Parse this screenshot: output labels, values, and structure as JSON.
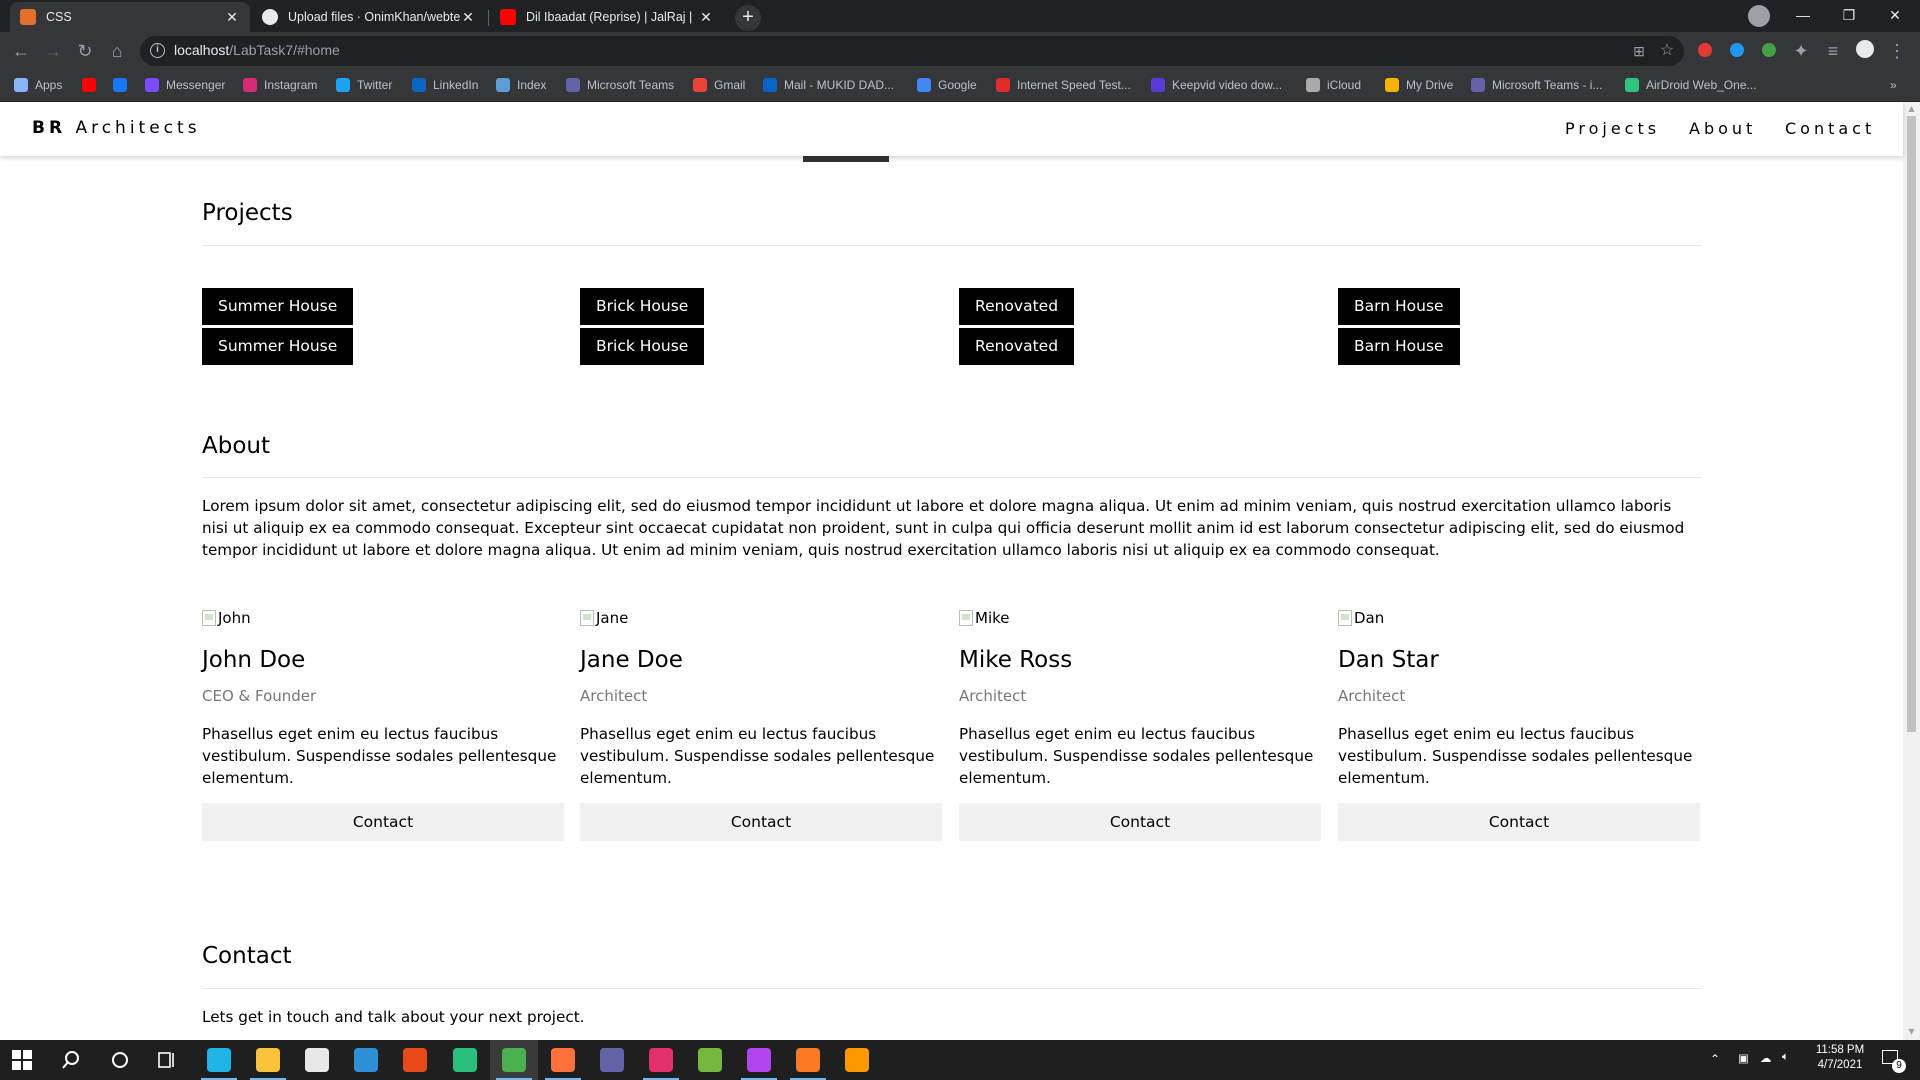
{
  "browser": {
    "tabs": [
      {
        "title": "CSS",
        "favicon_color": "#e3702d",
        "active": true
      },
      {
        "title": "Upload files · OnimKhan/webtech",
        "favicon_color": "#e8eaed",
        "active": false
      },
      {
        "title": "Dil Ibaadat (Reprise) | JalRaj |",
        "favicon_color": "#ff0000",
        "active": false
      }
    ],
    "address": {
      "host": "localhost",
      "path": "/LabTask7/#home"
    },
    "bookmarks": [
      {
        "label": "Apps",
        "icon": "apps-grid-icon",
        "color": "#8ab4f8"
      },
      {
        "label": "",
        "icon": "youtube-icon",
        "color": "#ff0000"
      },
      {
        "label": "",
        "icon": "facebook-icon",
        "color": "#1877f2"
      },
      {
        "label": "Messenger",
        "icon": "messenger-icon",
        "color": "#7b4dff"
      },
      {
        "label": "Instagram",
        "icon": "instagram-icon",
        "color": "#d62976"
      },
      {
        "label": "Twitter",
        "icon": "twitter-icon",
        "color": "#1da1f2"
      },
      {
        "label": "LinkedIn",
        "icon": "linkedin-icon",
        "color": "#0a66c2"
      },
      {
        "label": "Index",
        "icon": "index-icon",
        "color": "#5f9bd5"
      },
      {
        "label": "Microsoft Teams",
        "icon": "teams-icon",
        "color": "#6264a7"
      },
      {
        "label": "Gmail",
        "icon": "gmail-icon",
        "color": "#ea4335"
      },
      {
        "label": "Mail - MUKID DAD...",
        "icon": "outlook-icon",
        "color": "#0a64c8"
      },
      {
        "label": "Google",
        "icon": "google-icon",
        "color": "#4285f4"
      },
      {
        "label": "Internet Speed Test...",
        "icon": "speedtest-icon",
        "color": "#e22b2b"
      },
      {
        "label": "Keepvid video dow...",
        "icon": "keepvid-icon",
        "color": "#5b3bd6"
      },
      {
        "label": "iCloud",
        "icon": "apple-icon",
        "color": "#aaaaaa"
      },
      {
        "label": "My Drive",
        "icon": "drive-icon",
        "color": "#f4b400"
      },
      {
        "label": "Microsoft Teams - i...",
        "icon": "teams-icon",
        "color": "#6264a7"
      },
      {
        "label": "AirDroid Web_One...",
        "icon": "airdroid-icon",
        "color": "#31c27c"
      }
    ]
  },
  "site": {
    "brand_bold": "BR",
    "brand_rest": "Architects",
    "nav": [
      "Projects",
      "About",
      "Contact"
    ],
    "projects": {
      "title": "Projects",
      "tags": [
        [
          "Summer House",
          "Summer House"
        ],
        [
          "Brick House",
          "Brick House"
        ],
        [
          "Renovated",
          "Renovated"
        ],
        [
          "Barn House",
          "Barn House"
        ]
      ]
    },
    "about": {
      "title": "About",
      "text": "Lorem ipsum dolor sit amet, consectetur adipiscing elit, sed do eiusmod tempor incididunt ut labore et dolore magna aliqua. Ut enim ad minim veniam, quis nostrud exercitation ullamco laboris nisi ut aliquip ex ea commodo consequat. Excepteur sint occaecat cupidatat non proident, sunt in culpa qui officia deserunt mollit anim id est laborum consectetur adipiscing elit, sed do eiusmod tempor incididunt ut labore et dolore magna aliqua. Ut enim ad minim veniam, quis nostrud exercitation ullamco laboris nisi ut aliquip ex ea commodo consequat."
    },
    "team": [
      {
        "alt": "John",
        "name": "John Doe",
        "role": "CEO & Founder",
        "bio": "Phasellus eget enim eu lectus faucibus vestibulum. Suspendisse sodales pellentesque elementum.",
        "button": "Contact"
      },
      {
        "alt": "Jane",
        "name": "Jane Doe",
        "role": "Architect",
        "bio": "Phasellus eget enim eu lectus faucibus vestibulum. Suspendisse sodales pellentesque elementum.",
        "button": "Contact"
      },
      {
        "alt": "Mike",
        "name": "Mike Ross",
        "role": "Architect",
        "bio": "Phasellus eget enim eu lectus faucibus vestibulum. Suspendisse sodales pellentesque elementum.",
        "button": "Contact"
      },
      {
        "alt": "Dan",
        "name": "Dan Star",
        "role": "Architect",
        "bio": "Phasellus eget enim eu lectus faucibus vestibulum. Suspendisse sodales pellentesque elementum.",
        "button": "Contact"
      }
    ],
    "contact": {
      "title": "Contact",
      "text": "Lets get in touch and talk about your next project."
    }
  },
  "taskbar": {
    "apps": [
      {
        "icon": "edge-icon",
        "color": "#1fb4e6"
      },
      {
        "icon": "file-explorer-icon",
        "color": "#f9c23c"
      },
      {
        "icon": "store-icon",
        "color": "#e8e8e8"
      },
      {
        "icon": "mail-icon",
        "color": "#2d8fd5"
      },
      {
        "icon": "office-icon",
        "color": "#e64a19"
      },
      {
        "icon": "upwork-icon",
        "color": "#2bbf7d"
      },
      {
        "icon": "chrome-icon",
        "color": "#4caf50"
      },
      {
        "icon": "firefox-icon",
        "color": "#ff7139"
      },
      {
        "icon": "teams-icon",
        "color": "#6264a7"
      },
      {
        "icon": "instagram-app-icon",
        "color": "#e1306c"
      },
      {
        "icon": "utorrent-icon",
        "color": "#76b83f"
      },
      {
        "icon": "phpstorm-icon",
        "color": "#b345f1"
      },
      {
        "icon": "xampp-icon",
        "color": "#fb7a24"
      },
      {
        "icon": "sublime-icon",
        "color": "#ff9800"
      }
    ],
    "time": "11:58 PM",
    "date": "4/7/2021",
    "notifications": "9"
  }
}
